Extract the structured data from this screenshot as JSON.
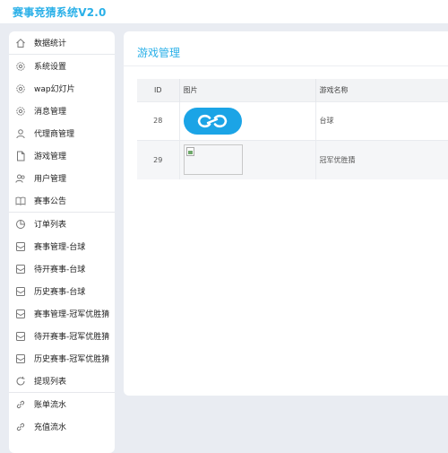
{
  "app": {
    "title": "赛事竞猜系统V2.0"
  },
  "sidebar": {
    "groups": [
      [
        {
          "label": "数据统计",
          "icon": "home-icon"
        }
      ],
      [
        {
          "label": "系统设置",
          "icon": "gear-icon"
        },
        {
          "label": "wap幻灯片",
          "icon": "gear-icon"
        },
        {
          "label": "消息管理",
          "icon": "gear-icon"
        },
        {
          "label": "代理商管理",
          "icon": "user-icon"
        },
        {
          "label": "游戏管理",
          "icon": "document-icon"
        },
        {
          "label": "用户管理",
          "icon": "users-icon"
        },
        {
          "label": "赛事公告",
          "icon": "book-icon"
        }
      ],
      [
        {
          "label": "订单列表",
          "icon": "pie-chart-icon"
        },
        {
          "label": "赛事管理-台球",
          "icon": "mail-icon"
        },
        {
          "label": "待开赛事-台球",
          "icon": "mail-icon"
        },
        {
          "label": "历史赛事-台球",
          "icon": "mail-icon"
        },
        {
          "label": "赛事管理-冠军优胜猜",
          "icon": "mail-icon"
        },
        {
          "label": "待开赛事-冠军优胜猜",
          "icon": "mail-icon"
        },
        {
          "label": "历史赛事-冠军优胜猜",
          "icon": "mail-icon"
        },
        {
          "label": "提现列表",
          "icon": "refresh-icon"
        }
      ],
      [
        {
          "label": "账单流水",
          "icon": "link-icon"
        },
        {
          "label": "充值流水",
          "icon": "link-icon"
        }
      ]
    ]
  },
  "main": {
    "title": "游戏管理",
    "table": {
      "headers": {
        "id": "ID",
        "image": "图片",
        "name": "游戏名称"
      },
      "rows": [
        {
          "id": "28",
          "name": "台球"
        },
        {
          "id": "29",
          "name": "冠军优胜猜"
        }
      ]
    }
  },
  "colors": {
    "accent": "#2ab0e8",
    "background": "#e9ecf2"
  }
}
